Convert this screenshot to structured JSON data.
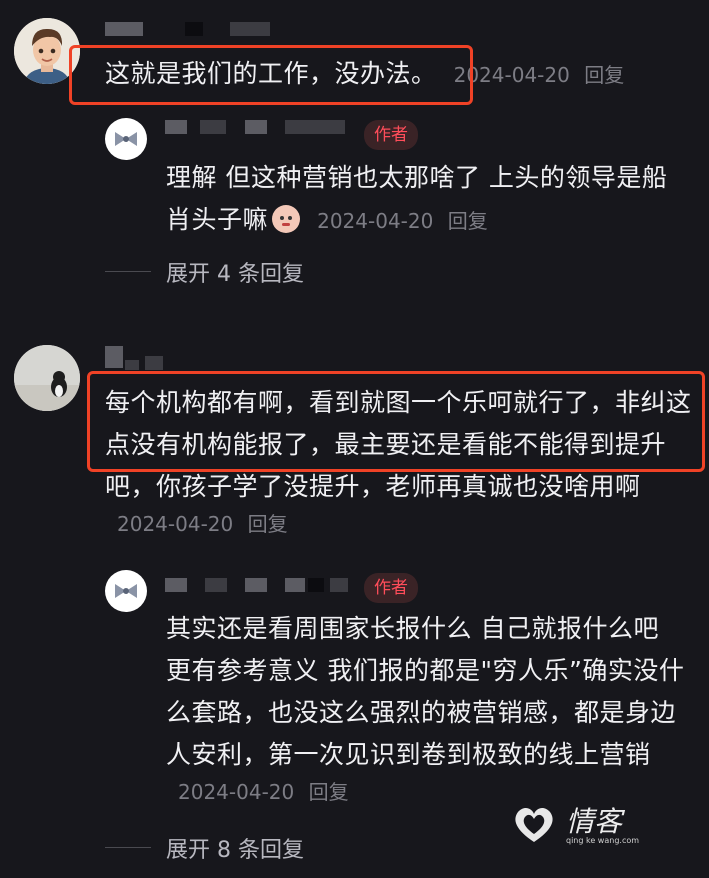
{
  "comments": [
    {
      "text": "这就是我们的工作，没办法。",
      "date": "2024-04-20",
      "reply_label": "回复",
      "sub": {
        "badge": "作者",
        "text": "理解 但这种营销也太那啥了 上头的领导是船肖头子嘛",
        "date": "2024-04-20",
        "reply_label": "回复",
        "emoji": "baby-face-emoji"
      },
      "expand": "展开 4 条回复"
    },
    {
      "text": "每个机构都有啊，看到就图一个乐呵就行了，非纠这点没有机构能报了，最主要还是看能不能得到提升吧，你孩子学了没提升，老师再真诚也没啥用啊",
      "date": "2024-04-20",
      "reply_label": "回复",
      "sub": {
        "badge": "作者",
        "text": "其实还是看周围家长报什么 自己就报什么吧 更有参考意义 我们报的都是\"穷人乐”确实没什么套路，也没这么强烈的被营销感，都是身边人安利，第一次见识到卷到极致的线上营销",
        "date": "2024-04-20",
        "reply_label": "回复"
      },
      "expand": "展开 8 条回复"
    }
  ],
  "watermark": {
    "text": "情客",
    "url": "qing ke wang.com"
  },
  "colors": {
    "highlight": "#f04226",
    "badge_text": "#ff4d5a",
    "background": "#17171c"
  }
}
